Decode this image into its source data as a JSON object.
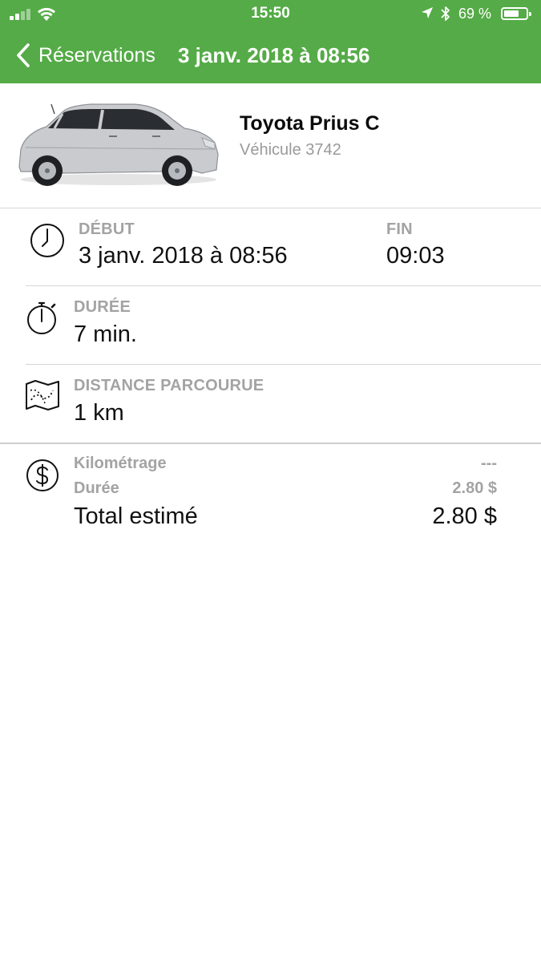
{
  "status_bar": {
    "time": "15:50",
    "battery_text": "69 %",
    "battery_level": 0.69
  },
  "nav": {
    "back_label": "Réservations",
    "title": "3 janv. 2018 à 08:56"
  },
  "vehicle": {
    "name": "Toyota Prius C",
    "subtitle": "Véhicule 3742"
  },
  "details": {
    "start_label": "DÉBUT",
    "start_value": "3 janv. 2018 à 08:56",
    "end_label": "FIN",
    "end_value": "09:03",
    "duration_label": "DURÉE",
    "duration_value": "7 min.",
    "distance_label": "DISTANCE PARCOURUE",
    "distance_value": "1 km"
  },
  "fees": {
    "mileage_label": "Kilométrage",
    "mileage_value": "---",
    "duration_label": "Durée",
    "duration_value": "2.80 $",
    "total_label": "Total estimé",
    "total_value": "2.80 $"
  },
  "colors": {
    "header_green": "#55ab47",
    "label_gray": "#a3a3a3"
  },
  "icons": [
    "signal-icon",
    "wifi-icon",
    "location-arrow-icon",
    "bluetooth-icon",
    "battery-icon",
    "chevron-left-icon",
    "clock-icon",
    "stopwatch-icon",
    "map-route-icon",
    "dollar-circle-icon"
  ]
}
